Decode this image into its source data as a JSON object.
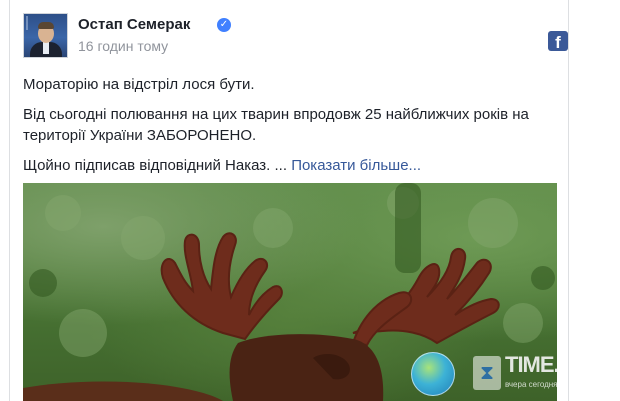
{
  "post": {
    "author": "Остап Семерак",
    "verified_icon": "verified-check-icon",
    "time": "16 годин тому",
    "platform_icon": "facebook-icon",
    "paragraphs": [
      "Мораторію на відстріл лося бути.",
      "Від сьогодні полювання на цих тварин впродовж 25 найближчих років на території України ЗАБОРОНЕНО."
    ],
    "last_line": "Щойно підписав відповідний Наказ. ...",
    "show_more": "Показати більше..."
  },
  "watermark": {
    "brand": "TIME.KG",
    "tagline": "вчера сегодня завтра"
  },
  "colors": {
    "link": "#365899",
    "facebook": "#3b5998",
    "verified": "#4080ff",
    "meta": "#90949c",
    "text": "#1d2129"
  }
}
